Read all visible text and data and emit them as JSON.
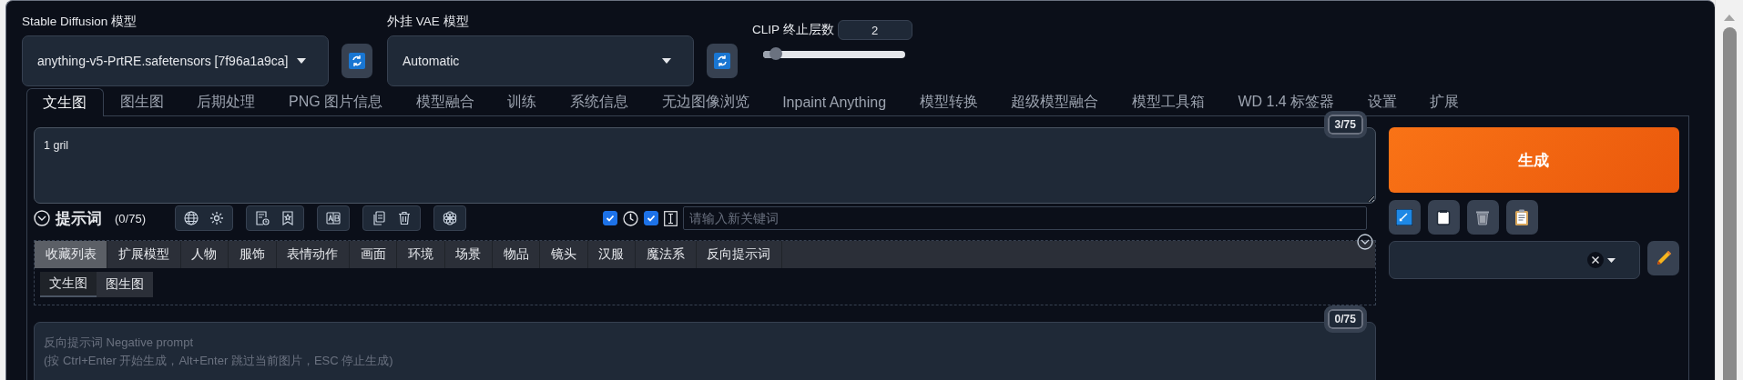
{
  "model_selectors": [
    {
      "label": "Stable Diffusion 模型",
      "value": "anything-v5-PrtRE.safetensors [7f96a1a9ca]"
    },
    {
      "label": "外挂 VAE 模型",
      "value": "Automatic"
    }
  ],
  "clip_skip": {
    "label": "CLIP 终止层数",
    "value": "2",
    "level": 0.09
  },
  "tabs": [
    {
      "label": "文生图",
      "selected": true
    },
    {
      "label": "图生图",
      "selected": false
    },
    {
      "label": "后期处理",
      "selected": false
    },
    {
      "label": "PNG 图片信息",
      "selected": false
    },
    {
      "label": "模型融合",
      "selected": false
    },
    {
      "label": "训练",
      "selected": false
    },
    {
      "label": "系统信息",
      "selected": false
    },
    {
      "label": "无边图像浏览",
      "selected": false
    },
    {
      "label": "Inpaint Anything",
      "selected": false
    },
    {
      "label": "模型转换",
      "selected": false
    },
    {
      "label": "超级模型融合",
      "selected": false
    },
    {
      "label": "模型工具箱",
      "selected": false
    },
    {
      "label": "WD 1.4 标签器",
      "selected": false
    },
    {
      "label": "设置",
      "selected": false
    },
    {
      "label": "扩展",
      "selected": false
    }
  ],
  "prompt": {
    "value": "1 gril",
    "counter": "3/75"
  },
  "prompt_toolbar": {
    "title": "提示词",
    "count": "(0/75)",
    "toggles": [
      {
        "checked": true
      },
      {
        "checked": true
      }
    ],
    "keyword_search": {
      "placeholder": "请输入新关键词"
    }
  },
  "categories": [
    {
      "label": "收藏列表",
      "selected": true
    },
    {
      "label": "扩展模型",
      "selected": false
    },
    {
      "label": "人物",
      "selected": false
    },
    {
      "label": "服饰",
      "selected": false
    },
    {
      "label": "表情动作",
      "selected": false
    },
    {
      "label": "画面",
      "selected": false
    },
    {
      "label": "环境",
      "selected": false
    },
    {
      "label": "场景",
      "selected": false
    },
    {
      "label": "物品",
      "selected": false
    },
    {
      "label": "镜头",
      "selected": false
    },
    {
      "label": "汉服",
      "selected": false
    },
    {
      "label": "魔法系",
      "selected": false
    },
    {
      "label": "反向提示词",
      "selected": false
    }
  ],
  "subtabs": [
    {
      "label": "文生图",
      "selected": true
    },
    {
      "label": "图生图",
      "selected": false
    }
  ],
  "negative_prompt": {
    "placeholder": "反向提示词 Negative prompt\n(按 Ctrl+Enter 开始生成，Alt+Enter 跳过当前图片，ESC 停止生成)",
    "counter": "0/75"
  },
  "generate_button": "生成"
}
